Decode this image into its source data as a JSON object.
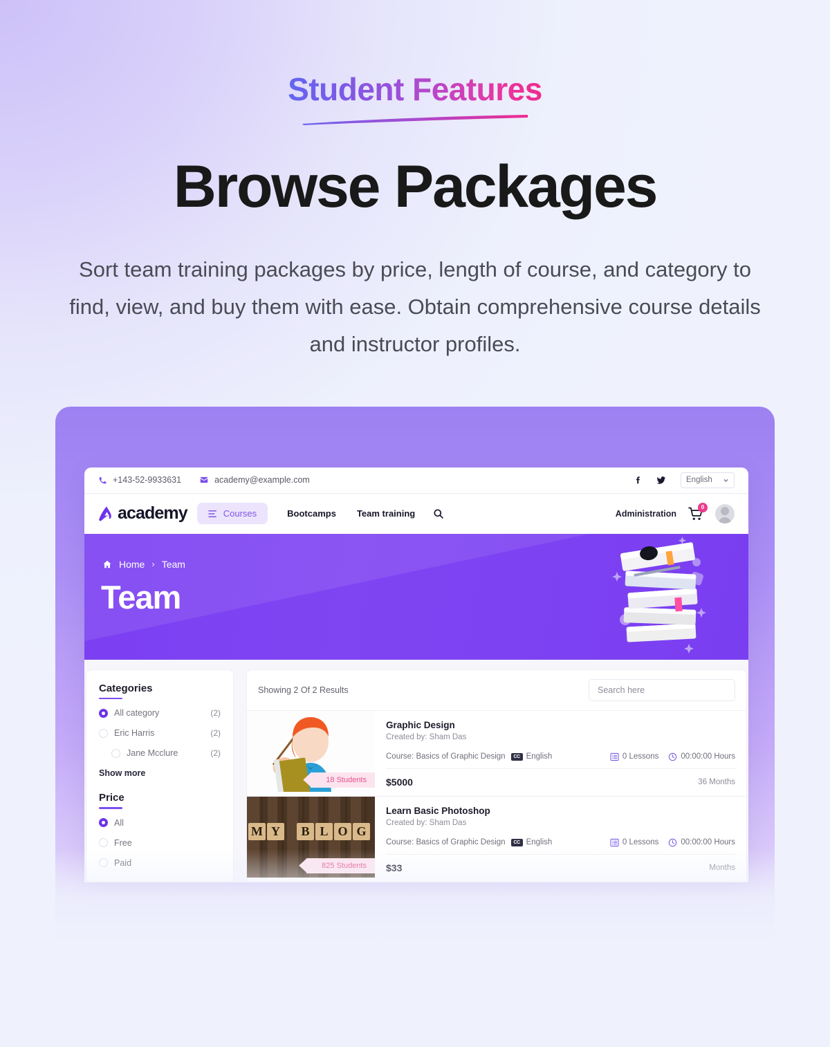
{
  "hero": {
    "eyebrow": "Student Features",
    "title": "Browse Packages",
    "description": "Sort team training packages by price, length of course, and category to find, view, and buy them with ease. Obtain comprehensive course details and instructor profiles."
  },
  "colors": {
    "accent_purple": "#7b4ef0",
    "accent_pink": "#ec3a8b",
    "banner_purple": "#7b3ff2",
    "page_bg": "#eff2fd",
    "badge_pink_bg": "#fce4ee",
    "badge_pink_text": "#e8508f"
  },
  "app": {
    "topbar": {
      "phone": "+143-52-9933631",
      "email": "academy@example.com",
      "social": [
        "facebook-icon",
        "twitter-icon"
      ],
      "language": "English"
    },
    "nav": {
      "logo_text": "academy",
      "courses_pill": "Courses",
      "links": [
        "Bootcamps",
        "Team training"
      ],
      "search_icon": "search-icon",
      "administration": "Administration",
      "cart_count": "0"
    },
    "banner": {
      "breadcrumb_home": "Home",
      "breadcrumb_sep": "›",
      "breadcrumb_current": "Team",
      "title": "Team"
    },
    "sidebar": {
      "categories_title": "Categories",
      "categories": [
        {
          "label": "All category",
          "count": "(2)",
          "selected": true,
          "indent": false
        },
        {
          "label": "Eric Harris",
          "count": "(2)",
          "selected": false,
          "indent": false
        },
        {
          "label": "Jane Mcclure",
          "count": "(2)",
          "selected": false,
          "indent": true
        }
      ],
      "show_more": "Show more",
      "price_title": "Price",
      "price_options": [
        {
          "label": "All",
          "selected": true
        },
        {
          "label": "Free",
          "selected": false
        },
        {
          "label": "Paid",
          "selected": false
        }
      ]
    },
    "results": {
      "count_text": "Showing 2 Of 2 Results",
      "search_placeholder": "Search here",
      "cards": [
        {
          "title": "Graphic Design",
          "author": "Created by: Sham Das",
          "course": "Course: Basics of Graphic Design",
          "cc_label": "CC",
          "language": "English",
          "lessons": "0 Lessons",
          "hours": "00:00:00 Hours",
          "price": "$5000",
          "duration": "36 Months",
          "students": "18 Students",
          "thumb": "teacher-illustration"
        },
        {
          "title": "Learn Basic Photoshop",
          "author": "Created by: Sham Das",
          "course": "Course: Basics of Graphic Design",
          "cc_label": "CC",
          "language": "English",
          "lessons": "0 Lessons",
          "hours": "00:00:00 Hours",
          "price": "$33",
          "duration": "Months",
          "students": "825 Students",
          "thumb": "my-blog-wood-tiles"
        }
      ]
    }
  }
}
